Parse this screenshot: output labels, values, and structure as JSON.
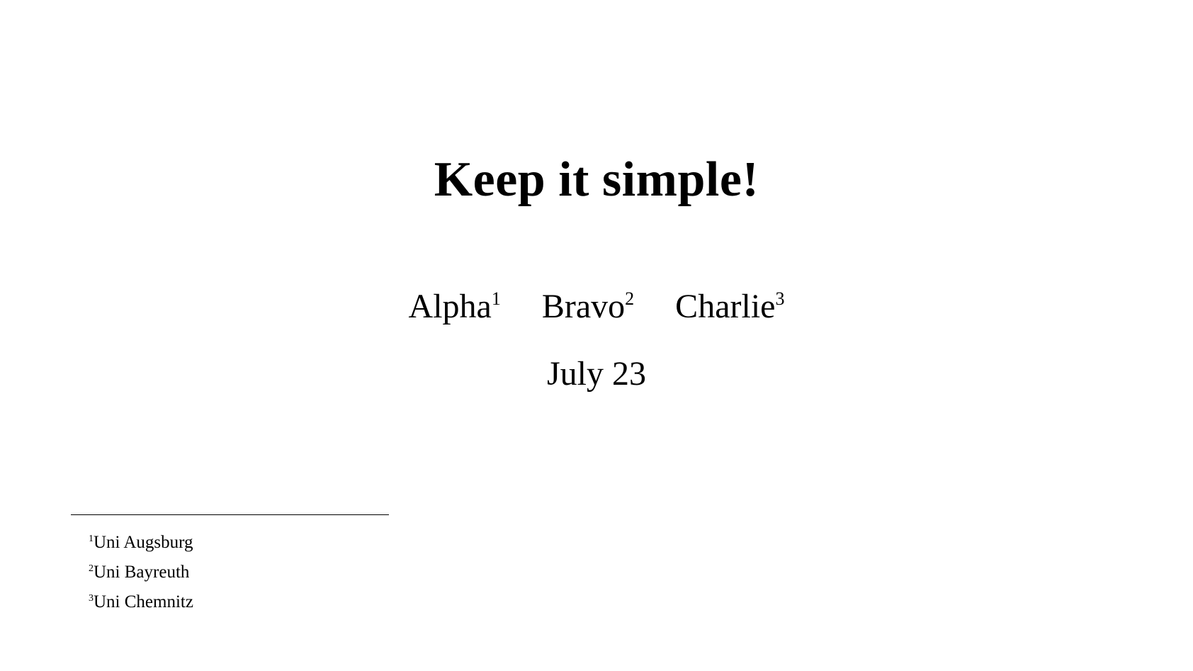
{
  "slide": {
    "title": "Keep it simple!",
    "authors": [
      {
        "name": "Alpha",
        "mark": "1"
      },
      {
        "name": "Bravo",
        "mark": "2"
      },
      {
        "name": "Charlie",
        "mark": "3"
      }
    ],
    "date": "July 23",
    "footnotes": [
      {
        "mark": "1",
        "text": "Uni Augsburg"
      },
      {
        "mark": "2",
        "text": "Uni Bayreuth"
      },
      {
        "mark": "3",
        "text": "Uni Chemnitz"
      }
    ]
  }
}
